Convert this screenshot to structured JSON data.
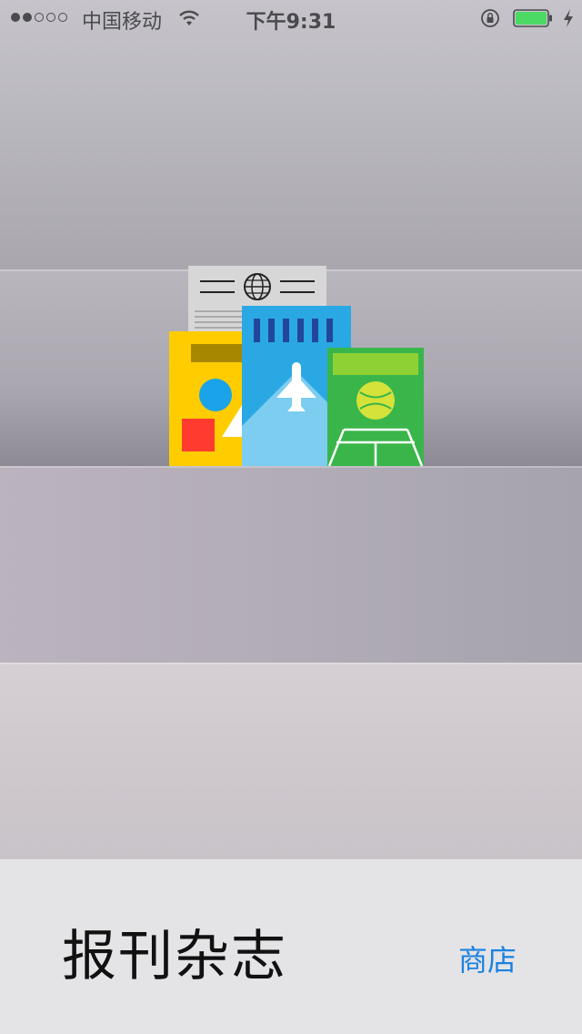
{
  "status_bar": {
    "carrier": "中国移动",
    "time": "下午9:31",
    "signal_bars_filled": 2,
    "signal_bars_total": 5,
    "battery_level": 1.0,
    "icons": [
      "signal-dots-icon",
      "wifi-icon",
      "rotation-lock-icon",
      "battery-icon",
      "charging-bolt-icon"
    ]
  },
  "newsstand": {
    "title": "报刊杂志",
    "store_label": "商店",
    "icon": "newsstand-magazines-icon"
  },
  "colors": {
    "accent": "#1a82e2",
    "battery_fill": "#4cd964"
  }
}
